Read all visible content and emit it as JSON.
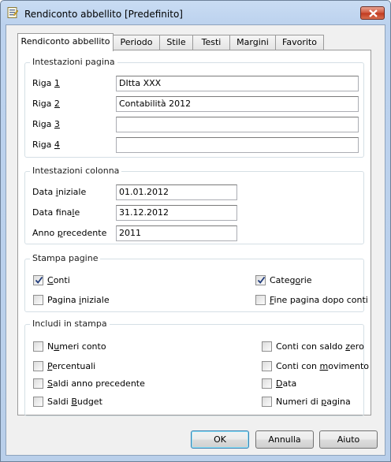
{
  "window": {
    "title": "Rendiconto abbellito [Predefinito]"
  },
  "tabs": [
    "Rendiconto abbellito",
    "Periodo",
    "Stile",
    "Testi",
    "Margini",
    "Favorito"
  ],
  "page_headers": {
    "title": "Intestazioni pagina",
    "rows": [
      {
        "pre": "Riga ",
        "acc": "1",
        "post": "",
        "value": "DItta XXX"
      },
      {
        "pre": "Riga ",
        "acc": "2",
        "post": "",
        "value": "Contabilità 2012"
      },
      {
        "pre": "Riga ",
        "acc": "3",
        "post": "",
        "value": ""
      },
      {
        "pre": "Riga ",
        "acc": "4",
        "post": "",
        "value": ""
      }
    ]
  },
  "column_headers": {
    "title": "Intestazioni colonna",
    "rows": [
      {
        "pre": "Data ",
        "acc": "i",
        "post": "niziale",
        "value": "01.01.2012"
      },
      {
        "pre": "Data fina",
        "acc": "l",
        "post": "e",
        "value": "31.12.2012"
      },
      {
        "pre": "Anno ",
        "acc": "p",
        "post": "recedente",
        "value": "2011"
      }
    ]
  },
  "print_pages": {
    "title": "Stampa pagine",
    "items": [
      {
        "pre": "",
        "acc": "C",
        "post": "onti",
        "checked": true
      },
      {
        "pre": "Categ",
        "acc": "o",
        "post": "rie",
        "checked": true
      },
      {
        "pre": "Pagina ",
        "acc": "i",
        "post": "niziale",
        "checked": false
      },
      {
        "pre": "",
        "acc": "F",
        "post": "ine pagina dopo conti",
        "checked": false
      }
    ]
  },
  "include": {
    "title": "Includi in stampa",
    "items": [
      {
        "pre": "N",
        "acc": "u",
        "post": "meri conto",
        "checked": false
      },
      {
        "pre": "Conti con saldo ",
        "acc": "z",
        "post": "ero",
        "checked": false
      },
      {
        "pre": "",
        "acc": "P",
        "post": "ercentuali",
        "checked": false
      },
      {
        "pre": "Conti con ",
        "acc": "m",
        "post": "ovimento",
        "checked": false
      },
      {
        "pre": "",
        "acc": "S",
        "post": "aldi anno precedente",
        "checked": false
      },
      {
        "pre": "",
        "acc": "D",
        "post": "ata",
        "checked": false
      },
      {
        "pre": "Saldi ",
        "acc": "B",
        "post": "udget",
        "checked": false
      },
      {
        "pre": "Numeri di ",
        "acc": "p",
        "post": "agina",
        "checked": false
      }
    ]
  },
  "buttons": {
    "ok": "OK",
    "cancel": "Annulla",
    "help": "Aiuto"
  },
  "icons": {
    "app": "report-document-icon",
    "close": "close-icon",
    "check": "checkmark-icon"
  }
}
